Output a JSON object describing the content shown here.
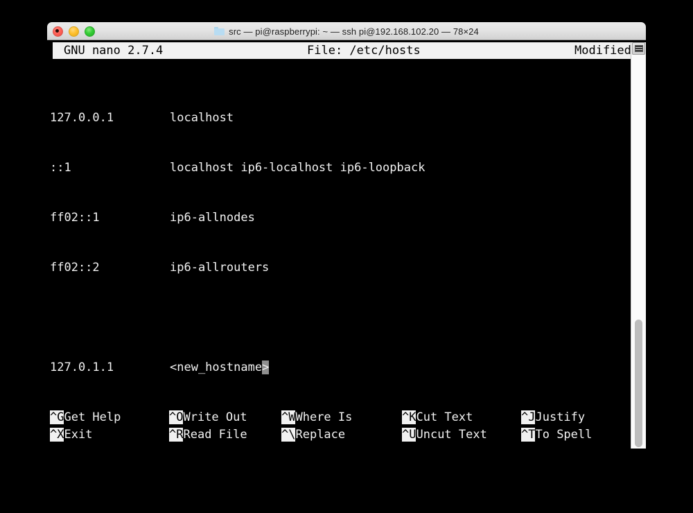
{
  "window": {
    "title": "src — pi@raspberrypi: ~ — ssh pi@192.168.102.20 — 78×24",
    "folder_icon": "folder-icon",
    "controls": {
      "close": "close-button",
      "minimize": "minimize-button",
      "zoom": "zoom-button"
    }
  },
  "editor": {
    "name": "GNU nano 2.7.4",
    "file_label": "File: /etc/hosts",
    "status": "Modified",
    "lines": [
      {
        "addr": "127.0.0.1",
        "host": "localhost"
      },
      {
        "addr": "::1",
        "host": "localhost ip6-localhost ip6-loopback"
      },
      {
        "addr": "ff02::1",
        "host": "ip6-allnodes"
      },
      {
        "addr": "ff02::2",
        "host": "ip6-allrouters"
      },
      {
        "addr": "",
        "host": ""
      },
      {
        "addr": "127.0.1.1",
        "host": "<new_hostname>"
      }
    ],
    "cursor": {
      "line": 5,
      "text_before": "<new_hostname",
      "char": ">"
    },
    "shortcuts_row1": [
      {
        "key": "^G",
        "label": "Get Help"
      },
      {
        "key": "^O",
        "label": "Write Out"
      },
      {
        "key": "^W",
        "label": "Where Is"
      },
      {
        "key": "^K",
        "label": "Cut Text"
      },
      {
        "key": "^J",
        "label": "Justify"
      }
    ],
    "shortcuts_row2": [
      {
        "key": "^X",
        "label": "Exit"
      },
      {
        "key": "^R",
        "label": "Read File"
      },
      {
        "key": "^\\",
        "label": "Replace"
      },
      {
        "key": "^U",
        "label": "Uncut Text"
      },
      {
        "key": "^T",
        "label": "To Spell"
      }
    ]
  },
  "colors": {
    "terminal_bg": "#000000",
    "terminal_fg": "#f2f2f2",
    "inverse_bg": "#f1f1f1",
    "inverse_fg": "#000000",
    "cursor_bg": "#8f8f8f",
    "titlebar_bg": "#e2e2e2",
    "close": "#ff6258",
    "minimize": "#ffc130",
    "zoom": "#35cd36"
  }
}
